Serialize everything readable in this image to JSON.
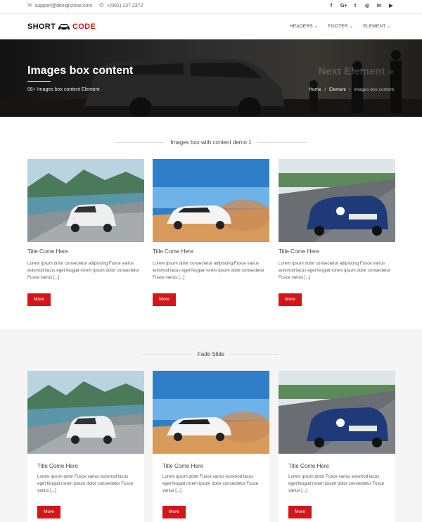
{
  "topbar": {
    "email": "support@dexignzone.com",
    "phone": "+(001) 237 2372",
    "social": [
      "f",
      "G+",
      "t",
      "in-ig",
      "in",
      "yt"
    ]
  },
  "logo": {
    "part1": "SHORT",
    "part2": "CODE"
  },
  "nav": [
    {
      "label": "HEADERS"
    },
    {
      "label": "FOOTER"
    },
    {
      "label": "ELEMENT"
    }
  ],
  "hero": {
    "title": "Images box content",
    "subtitle": "06+ Images box content Element",
    "ghost_text": "Next Element »",
    "breadcrumb": {
      "home": "Home",
      "sep1": "/",
      "element": "Element",
      "sep2": "/",
      "current": "Images box content"
    }
  },
  "section1": {
    "title": "Images box with content demo 1",
    "cards": [
      {
        "title": "Title Come Here",
        "text": "Lorem ipsum dolor consectetur adipiscing Fusce varius euismod lacus eget feugiat rorem ipsum dolor consectetur Fusce varius [...]",
        "button": "More"
      },
      {
        "title": "Title Come Here",
        "text": "Lorem ipsum dolor consectetur adipiscing Fusce varius euismod lacus eget feugiat rorem ipsum dolor consectetur Fusce varius [...]",
        "button": "More"
      },
      {
        "title": "Title Come Here",
        "text": "Lorem ipsum dolor consectetur adipiscing Fusce varius euismod lacus eget feugiat rorem ipsum dolor consectetur Fusce varius [...]",
        "button": "More"
      }
    ]
  },
  "section2": {
    "title": "Fade Slide",
    "cards": [
      {
        "title": "Title Come Here",
        "text": "Lorem ipsum dolor Fusce varius euismod lacus eget feugiat rorem ipsum dolor consectetur Fusce varius [...]",
        "button": "More"
      },
      {
        "title": "Title Come Here",
        "text": "Lorem ipsum dolor Fusce varius euismod lacus eget feugiat rorem ipsum dolor consectetur Fusce varius [...]",
        "button": "More"
      },
      {
        "title": "Title Come Here",
        "text": "Lorem ipsum dolor Fusce varius euismod lacus eget feugiat rorem ipsum dolor consectetur Fusce varius [...]",
        "button": "More"
      }
    ]
  },
  "colors": {
    "accent": "#d3161a",
    "text": "#444444",
    "section_bg": "#f5f5f5"
  }
}
